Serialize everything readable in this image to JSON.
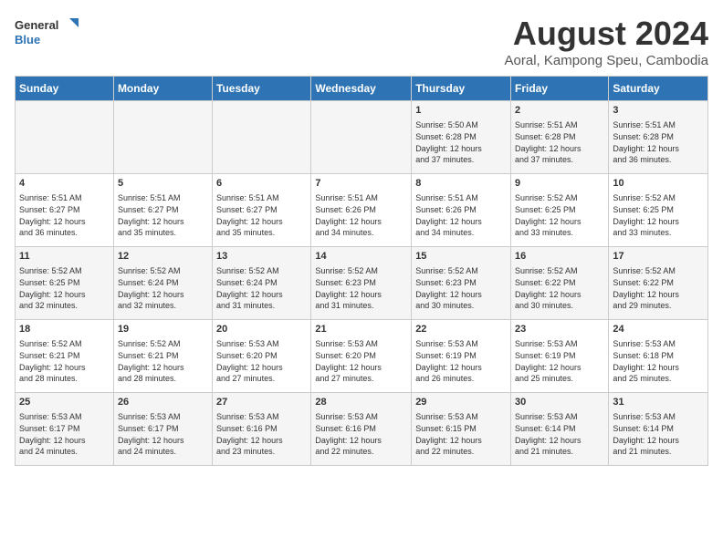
{
  "logo": {
    "line1": "General",
    "line2": "Blue"
  },
  "title": "August 2024",
  "location": "Aoral, Kampong Speu, Cambodia",
  "weekdays": [
    "Sunday",
    "Monday",
    "Tuesday",
    "Wednesday",
    "Thursday",
    "Friday",
    "Saturday"
  ],
  "weeks": [
    [
      {
        "day": "",
        "info": ""
      },
      {
        "day": "",
        "info": ""
      },
      {
        "day": "",
        "info": ""
      },
      {
        "day": "",
        "info": ""
      },
      {
        "day": "1",
        "info": "Sunrise: 5:50 AM\nSunset: 6:28 PM\nDaylight: 12 hours\nand 37 minutes."
      },
      {
        "day": "2",
        "info": "Sunrise: 5:51 AM\nSunset: 6:28 PM\nDaylight: 12 hours\nand 37 minutes."
      },
      {
        "day": "3",
        "info": "Sunrise: 5:51 AM\nSunset: 6:28 PM\nDaylight: 12 hours\nand 36 minutes."
      }
    ],
    [
      {
        "day": "4",
        "info": "Sunrise: 5:51 AM\nSunset: 6:27 PM\nDaylight: 12 hours\nand 36 minutes."
      },
      {
        "day": "5",
        "info": "Sunrise: 5:51 AM\nSunset: 6:27 PM\nDaylight: 12 hours\nand 35 minutes."
      },
      {
        "day": "6",
        "info": "Sunrise: 5:51 AM\nSunset: 6:27 PM\nDaylight: 12 hours\nand 35 minutes."
      },
      {
        "day": "7",
        "info": "Sunrise: 5:51 AM\nSunset: 6:26 PM\nDaylight: 12 hours\nand 34 minutes."
      },
      {
        "day": "8",
        "info": "Sunrise: 5:51 AM\nSunset: 6:26 PM\nDaylight: 12 hours\nand 34 minutes."
      },
      {
        "day": "9",
        "info": "Sunrise: 5:52 AM\nSunset: 6:25 PM\nDaylight: 12 hours\nand 33 minutes."
      },
      {
        "day": "10",
        "info": "Sunrise: 5:52 AM\nSunset: 6:25 PM\nDaylight: 12 hours\nand 33 minutes."
      }
    ],
    [
      {
        "day": "11",
        "info": "Sunrise: 5:52 AM\nSunset: 6:25 PM\nDaylight: 12 hours\nand 32 minutes."
      },
      {
        "day": "12",
        "info": "Sunrise: 5:52 AM\nSunset: 6:24 PM\nDaylight: 12 hours\nand 32 minutes."
      },
      {
        "day": "13",
        "info": "Sunrise: 5:52 AM\nSunset: 6:24 PM\nDaylight: 12 hours\nand 31 minutes."
      },
      {
        "day": "14",
        "info": "Sunrise: 5:52 AM\nSunset: 6:23 PM\nDaylight: 12 hours\nand 31 minutes."
      },
      {
        "day": "15",
        "info": "Sunrise: 5:52 AM\nSunset: 6:23 PM\nDaylight: 12 hours\nand 30 minutes."
      },
      {
        "day": "16",
        "info": "Sunrise: 5:52 AM\nSunset: 6:22 PM\nDaylight: 12 hours\nand 30 minutes."
      },
      {
        "day": "17",
        "info": "Sunrise: 5:52 AM\nSunset: 6:22 PM\nDaylight: 12 hours\nand 29 minutes."
      }
    ],
    [
      {
        "day": "18",
        "info": "Sunrise: 5:52 AM\nSunset: 6:21 PM\nDaylight: 12 hours\nand 28 minutes."
      },
      {
        "day": "19",
        "info": "Sunrise: 5:52 AM\nSunset: 6:21 PM\nDaylight: 12 hours\nand 28 minutes."
      },
      {
        "day": "20",
        "info": "Sunrise: 5:53 AM\nSunset: 6:20 PM\nDaylight: 12 hours\nand 27 minutes."
      },
      {
        "day": "21",
        "info": "Sunrise: 5:53 AM\nSunset: 6:20 PM\nDaylight: 12 hours\nand 27 minutes."
      },
      {
        "day": "22",
        "info": "Sunrise: 5:53 AM\nSunset: 6:19 PM\nDaylight: 12 hours\nand 26 minutes."
      },
      {
        "day": "23",
        "info": "Sunrise: 5:53 AM\nSunset: 6:19 PM\nDaylight: 12 hours\nand 25 minutes."
      },
      {
        "day": "24",
        "info": "Sunrise: 5:53 AM\nSunset: 6:18 PM\nDaylight: 12 hours\nand 25 minutes."
      }
    ],
    [
      {
        "day": "25",
        "info": "Sunrise: 5:53 AM\nSunset: 6:17 PM\nDaylight: 12 hours\nand 24 minutes."
      },
      {
        "day": "26",
        "info": "Sunrise: 5:53 AM\nSunset: 6:17 PM\nDaylight: 12 hours\nand 24 minutes."
      },
      {
        "day": "27",
        "info": "Sunrise: 5:53 AM\nSunset: 6:16 PM\nDaylight: 12 hours\nand 23 minutes."
      },
      {
        "day": "28",
        "info": "Sunrise: 5:53 AM\nSunset: 6:16 PM\nDaylight: 12 hours\nand 22 minutes."
      },
      {
        "day": "29",
        "info": "Sunrise: 5:53 AM\nSunset: 6:15 PM\nDaylight: 12 hours\nand 22 minutes."
      },
      {
        "day": "30",
        "info": "Sunrise: 5:53 AM\nSunset: 6:14 PM\nDaylight: 12 hours\nand 21 minutes."
      },
      {
        "day": "31",
        "info": "Sunrise: 5:53 AM\nSunset: 6:14 PM\nDaylight: 12 hours\nand 21 minutes."
      }
    ]
  ]
}
